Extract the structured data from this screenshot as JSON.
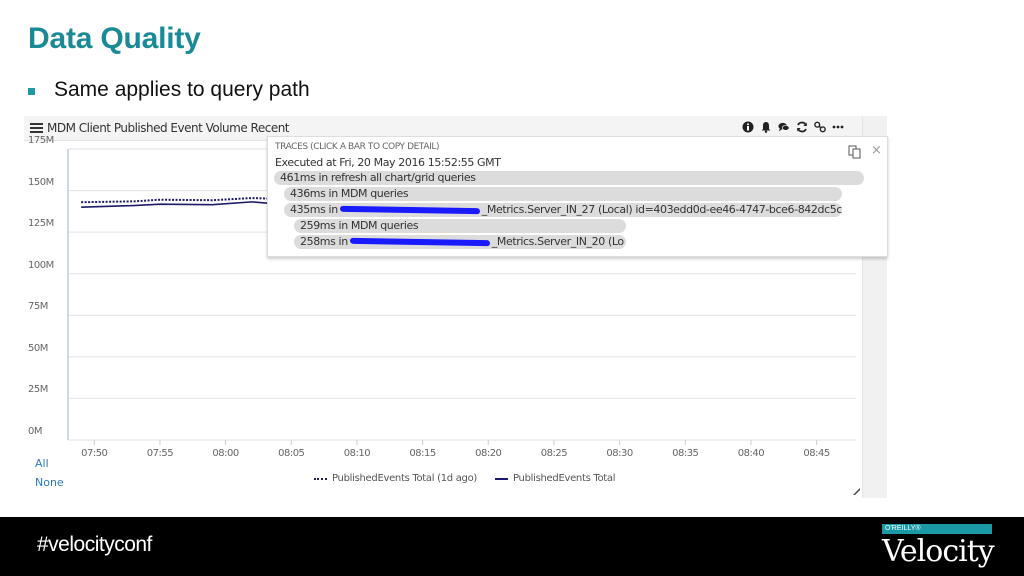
{
  "slide": {
    "title": "Data Quality",
    "bullet": "Same applies to query path",
    "accent_color": "#1a8a96"
  },
  "widget": {
    "title": "MDM Client Published Event Volume Recent",
    "header_icons": [
      "info-icon",
      "bell-icon",
      "comments-icon",
      "refresh-icon",
      "link-icon",
      "more-icon"
    ],
    "legend_toggle": {
      "all": "All",
      "none": "None"
    }
  },
  "chart_data": {
    "type": "line",
    "title": "MDM Client Published Event Volume Recent",
    "xlabel": "",
    "ylabel": "",
    "ylim": [
      0,
      175000000
    ],
    "yticks": [
      "0M",
      "25M",
      "50M",
      "75M",
      "100M",
      "125M",
      "150M",
      "175M"
    ],
    "ytick_values": [
      0,
      25000000,
      50000000,
      75000000,
      100000000,
      125000000,
      150000000,
      175000000
    ],
    "xticks": [
      "07:50",
      "07:55",
      "08:00",
      "08:05",
      "08:10",
      "08:15",
      "08:20",
      "08:25",
      "08:30",
      "08:35",
      "08:40",
      "08:45"
    ],
    "xlim_minutes": [
      -2,
      58
    ],
    "grid": true,
    "legend_position": "bottom",
    "series": [
      {
        "name": "PublishedEvents Total (1d ago)",
        "style": "dotted",
        "color": "#1d1a6b",
        "x_minutes": [
          -1,
          3,
          5,
          9,
          12,
          15,
          19,
          22,
          26,
          30
        ],
        "values": [
          143000000,
          143500000,
          144500000,
          144200000,
          145500000,
          144800000,
          145000000,
          144600000,
          145000000,
          144500000
        ]
      },
      {
        "name": "PublishedEvents Total",
        "style": "solid",
        "color": "#1d1a6b",
        "x_minutes": [
          -1,
          3,
          5,
          9,
          12,
          15,
          19,
          22,
          26,
          30
        ],
        "values": [
          140000000,
          141000000,
          141800000,
          141500000,
          143200000,
          141300000,
          141000000,
          141200000,
          141000000,
          141200000
        ]
      }
    ]
  },
  "traces": {
    "heading": "TRACES (CLICK A BAR TO COPY DETAIL)",
    "executed": "Executed at Fri, 20 May 2016 15:52:55 GMT",
    "rows": [
      {
        "pre": "461ms in refresh all chart/grid queries",
        "redacted": false,
        "post": ""
      },
      {
        "pre": "436ms in MDM queries",
        "redacted": false,
        "post": ""
      },
      {
        "pre": "435ms in",
        "redacted": true,
        "post": "_Metrics.Server_IN_27 (Local) id=403edd0d-ee46-4747-bce6-842dc5c"
      },
      {
        "pre": "259ms in MDM queries",
        "redacted": false,
        "post": ""
      },
      {
        "pre": "258ms in",
        "redacted": true,
        "post": "_Metrics.Server_IN_20 (Lo"
      }
    ],
    "close_label": "×"
  },
  "footer": {
    "hashtag": "#velocityconf",
    "brand_publisher": "O'REILLY®",
    "brand_name": "Velocity",
    "brand_color": "#1a9aa6"
  }
}
